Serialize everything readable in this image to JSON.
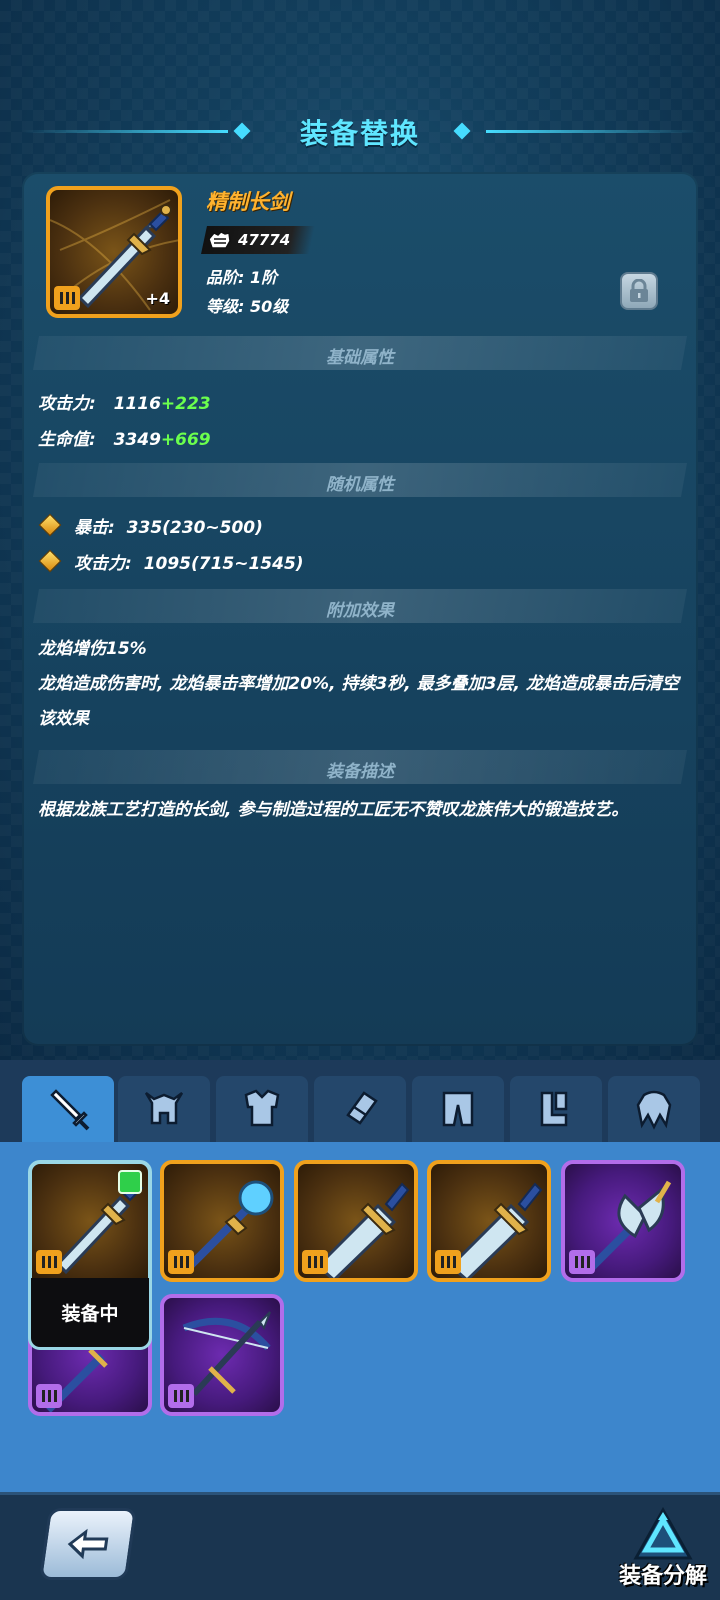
{
  "header": {
    "title": "装备替换"
  },
  "item": {
    "name": "精制长剑",
    "enhance": "+4",
    "power": "47774",
    "grade": "品阶: 1阶",
    "level": "等级: 50级"
  },
  "sections": {
    "base": "基础属性",
    "random": "随机属性",
    "effect": "附加效果",
    "desc": "装备描述"
  },
  "base_stats": [
    {
      "label": "攻击力:",
      "value": "1116",
      "bonus": "+223"
    },
    {
      "label": "生命值:",
      "value": "3349",
      "bonus": "+669"
    }
  ],
  "random_stats": [
    {
      "label": "暴击:",
      "value": "335(230~500)"
    },
    {
      "label": "攻击力:",
      "value": "1095(715~1545)"
    }
  ],
  "effect": {
    "name": "龙焰增伤15%",
    "text": "龙焰造成伤害时, 龙焰暴击率增加20%, 持续3秒, 最多叠加3层, 龙焰造成暴击后清空该效果"
  },
  "description": "根据龙族工艺打造的长剑, 参与制造过程的工匠无不赞叹龙族伟大的锻造技艺。",
  "tabs": [
    "weapon",
    "helmet",
    "armor",
    "bracer",
    "pants",
    "boots",
    "cloak"
  ],
  "inventory": {
    "equipped_label": "装备中",
    "slots": [
      {
        "icon": "long-sword-icon",
        "rarity": "orange",
        "equipped": true
      },
      {
        "icon": "magic-staff-icon",
        "rarity": "orange"
      },
      {
        "icon": "broad-sword-icon",
        "rarity": "orange"
      },
      {
        "icon": "broad-sword-icon",
        "rarity": "orange"
      },
      {
        "icon": "battle-axe-icon",
        "rarity": "purple"
      },
      {
        "icon": "sword-icon",
        "rarity": "purple"
      },
      {
        "icon": "crossbow-icon",
        "rarity": "purple"
      }
    ]
  },
  "footer": {
    "salvage_label": "装备分解"
  },
  "colors": {
    "accent": "#5fe6ff",
    "orange_rarity": "#f0a11d",
    "purple_rarity": "#b26dea",
    "bonus": "#6bff4d",
    "name": "#ffb22e"
  }
}
